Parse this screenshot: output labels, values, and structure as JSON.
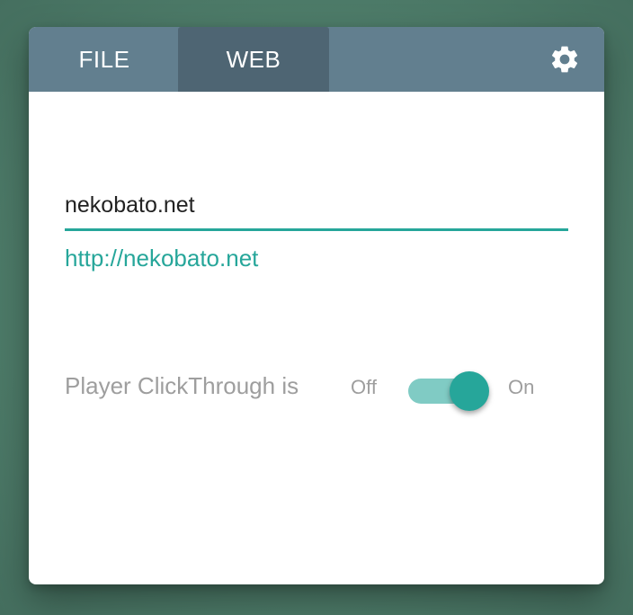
{
  "tabs": [
    {
      "label": "FILE",
      "active": false
    },
    {
      "label": "WEB",
      "active": true
    }
  ],
  "settings": {
    "icon": "gear-icon"
  },
  "web": {
    "url_value": "nekobato.net",
    "resolved_url": "http://nekobato.net"
  },
  "clickthrough": {
    "label": "Player ClickThrough is",
    "off_label": "Off",
    "on_label": "On",
    "state": "on"
  },
  "colors": {
    "tabbar": "#627f8f",
    "active_tab": "#4e6573",
    "accent": "#26a69a",
    "accent_light": "#80cbc4",
    "muted_text": "#9e9e9e"
  }
}
